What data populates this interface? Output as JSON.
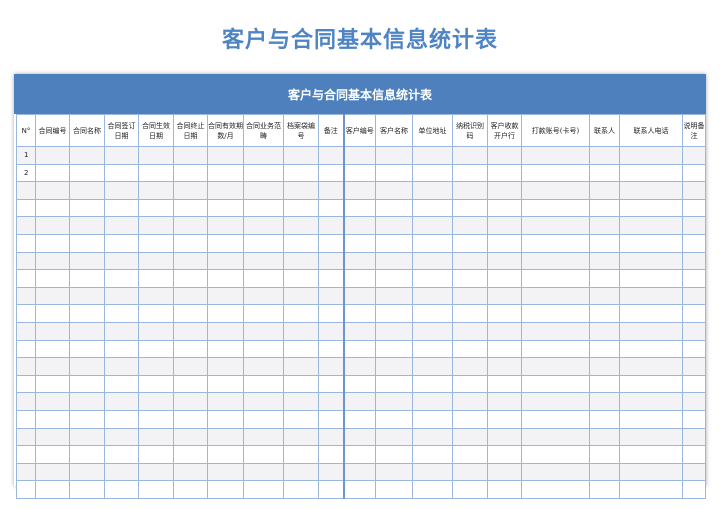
{
  "page_title": "客户与合同基本信息统计表",
  "table_title": "客户与合同基本信息统计表",
  "columns": [
    "N°",
    "合同编号",
    "合同名称",
    "合同签订日期",
    "合同生效日期",
    "合同终止日期",
    "合同有效期数/月",
    "合同业务范畴",
    "档案袋编号",
    "备注",
    "客户编号",
    "客户名称",
    "单位地址",
    "纳税识别码",
    "客户收款开户行",
    "打款账号(卡号)",
    "联系人",
    "联系人电话",
    "说明备注"
  ],
  "row_numbers": [
    "1",
    "2",
    "",
    "",
    "",
    "",
    "",
    "",
    "",
    "",
    "",
    "",
    "",
    "",
    "",
    "",
    "",
    "",
    "",
    ""
  ],
  "colors": {
    "title": "#4e84c4",
    "band": "#4d80bd",
    "grid": "#9ab8dd",
    "stripe": "#f3f3f5"
  }
}
